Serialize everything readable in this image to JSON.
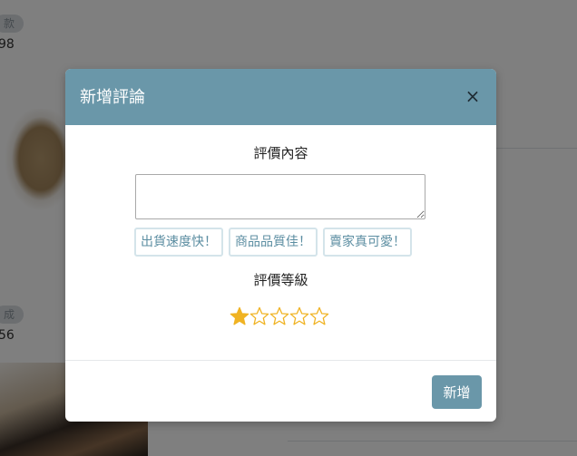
{
  "background": {
    "badge_1": "款",
    "number_1": "98",
    "badge_2": "成",
    "number_2": "56"
  },
  "modal": {
    "title": "新增評論",
    "close_label": "×",
    "comment_label": "評價內容",
    "comment_value": "",
    "quick_tags": [
      "出貨速度快！",
      "商品品質佳！",
      "賣家真可愛！"
    ],
    "rating_label": "評價等級",
    "rating": {
      "value": 1,
      "max": 5
    },
    "submit_label": "新增"
  },
  "colors": {
    "accent": "#6a97a9",
    "tag_text": "#5c8ea2",
    "tag_border": "#d4e4ea",
    "star_fill": "#f0b323",
    "star_outline": "#f0b323"
  }
}
